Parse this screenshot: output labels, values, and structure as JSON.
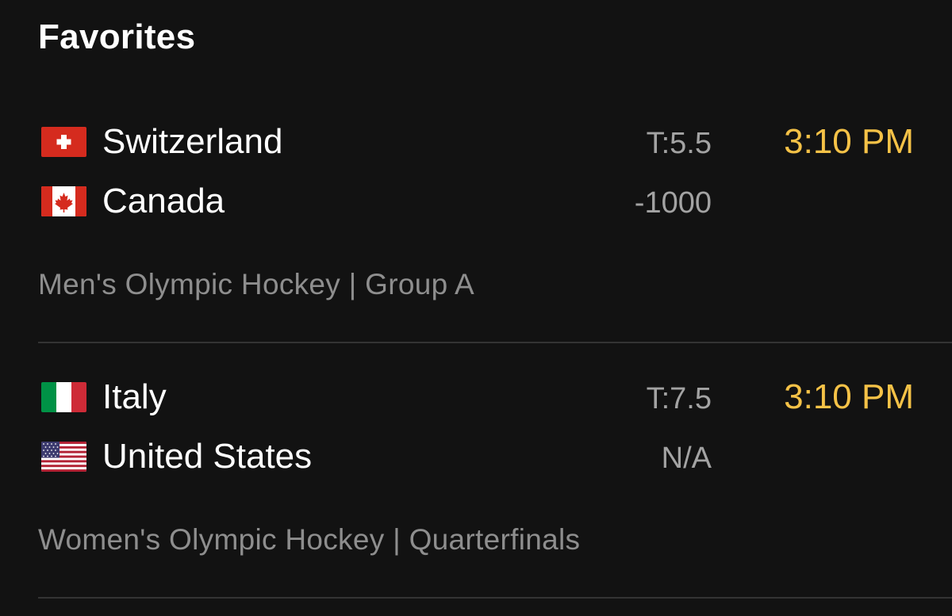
{
  "section": {
    "title": "Favorites"
  },
  "games": [
    {
      "teams": [
        {
          "name": "Switzerland",
          "flag_icon": "switzerland-flag-icon",
          "odds": "T:5.5"
        },
        {
          "name": "Canada",
          "flag_icon": "canada-flag-icon",
          "odds": "-1000"
        }
      ],
      "time": "3:10 PM",
      "league": "Men's Olympic Hockey | Group A"
    },
    {
      "teams": [
        {
          "name": "Italy",
          "flag_icon": "italy-flag-icon",
          "odds": "T:7.5"
        },
        {
          "name": "United States",
          "flag_icon": "usa-flag-icon",
          "odds": "N/A"
        }
      ],
      "time": "3:10 PM",
      "league": "Women's Olympic Hockey | Quarterfinals"
    }
  ],
  "colors": {
    "background": "#121212",
    "time_accent": "#f5c247",
    "secondary_text": "#8e8e8e",
    "odds_text": "#a3a3a3",
    "divider": "#333333"
  }
}
